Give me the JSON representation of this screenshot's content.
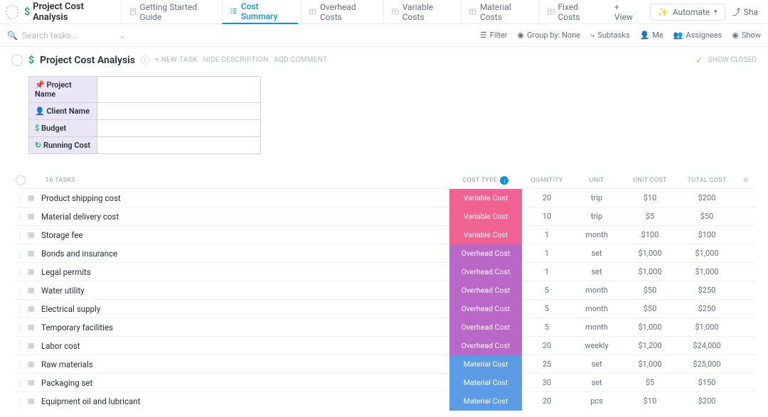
{
  "header": {
    "title": "Project Cost Analysis",
    "tabs": [
      {
        "label": "Getting Started Guide"
      },
      {
        "label": "Cost Summary"
      },
      {
        "label": "Overhead Costs"
      },
      {
        "label": "Variable Costs"
      },
      {
        "label": "Material Costs"
      },
      {
        "label": "Fixed Costs"
      }
    ],
    "add_view": "+  View",
    "automate": "Automate",
    "share": "Sha"
  },
  "toolbar": {
    "search_placeholder": "Search tasks...",
    "filter": "Filter",
    "group_by": "Group by: None",
    "subtasks": "Subtasks",
    "me": "Me",
    "assignees": "Assignees",
    "show": "Show"
  },
  "list": {
    "title": "Project Cost Analysis",
    "new_task": "+ NEW TASK",
    "hide_desc": "HIDE DESCRIPTION",
    "add_comment": "ADD COMMENT",
    "show_closed": "SHOW CLOSED"
  },
  "meta": [
    {
      "icon": "📌",
      "label": "Project Name",
      "value": ""
    },
    {
      "icon": "👤",
      "label": "Client Name",
      "value": ""
    },
    {
      "icon": "$",
      "label": "Budget",
      "value": ""
    },
    {
      "icon": "↻",
      "label": "Running Cost",
      "value": ""
    }
  ],
  "columns": {
    "count": "16 TASKS",
    "cost_type": "COST TYPE",
    "quantity": "QUANTITY",
    "unit": "UNIT",
    "unit_cost": "UNIT COST",
    "total_cost": "TOTAL COST"
  },
  "tasks": [
    {
      "name": "Product shipping cost",
      "type": "Variable Cost",
      "type_class": "variable",
      "qty": "20",
      "unit": "trip",
      "unit_cost": "$10",
      "total": "$200"
    },
    {
      "name": "Material delivery cost",
      "type": "Variable Cost",
      "type_class": "variable",
      "qty": "10",
      "unit": "trip",
      "unit_cost": "$5",
      "total": "$50"
    },
    {
      "name": "Storage fee",
      "type": "Variable Cost",
      "type_class": "variable",
      "qty": "1",
      "unit": "month",
      "unit_cost": "$100",
      "total": "$100"
    },
    {
      "name": "Bonds and insurance",
      "type": "Overhead Cost",
      "type_class": "overhead",
      "qty": "1",
      "unit": "set",
      "unit_cost": "$1,000",
      "total": "$1,000"
    },
    {
      "name": "Legal permits",
      "type": "Overhead Cost",
      "type_class": "overhead",
      "qty": "1",
      "unit": "set",
      "unit_cost": "$1,000",
      "total": "$1,000"
    },
    {
      "name": "Water utility",
      "type": "Overhead Cost",
      "type_class": "overhead",
      "qty": "5",
      "unit": "month",
      "unit_cost": "$50",
      "total": "$250"
    },
    {
      "name": "Electrical supply",
      "type": "Overhead Cost",
      "type_class": "overhead",
      "qty": "5",
      "unit": "month",
      "unit_cost": "$50",
      "total": "$250"
    },
    {
      "name": "Temporary facilities",
      "type": "Overhead Cost",
      "type_class": "overhead",
      "qty": "5",
      "unit": "month",
      "unit_cost": "$1,000",
      "total": "$1,000"
    },
    {
      "name": "Labor cost",
      "type": "Overhead Cost",
      "type_class": "overhead",
      "qty": "20",
      "unit": "weekly",
      "unit_cost": "$1,200",
      "total": "$24,000"
    },
    {
      "name": "Raw materials",
      "type": "Material Cost",
      "type_class": "material",
      "qty": "25",
      "unit": "set",
      "unit_cost": "$1,000",
      "total": "$25,000"
    },
    {
      "name": "Packaging set",
      "type": "Material Cost",
      "type_class": "material",
      "qty": "30",
      "unit": "set",
      "unit_cost": "$5",
      "total": "$150"
    },
    {
      "name": "Equipment oil and lubricant",
      "type": "Material Cost",
      "type_class": "material",
      "qty": "20",
      "unit": "pcs",
      "unit_cost": "$10",
      "total": "$200"
    }
  ]
}
